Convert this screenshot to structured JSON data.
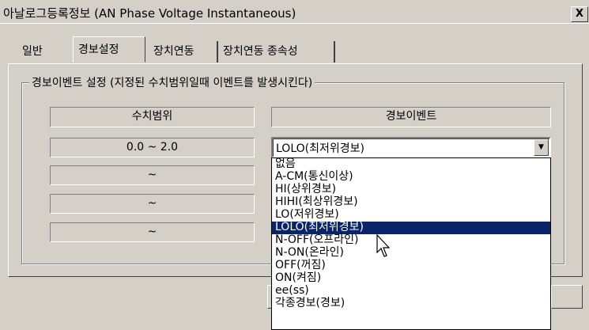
{
  "window": {
    "title": "아날로그등록정보 (AN Phase Voltage Instantaneous)",
    "close_label": "X"
  },
  "tabs": [
    "일반",
    "경보설정",
    "장치연동",
    "장치연동 종속성"
  ],
  "active_tab": "경보설정",
  "group": {
    "title": "경보이벤트 설정 (지정된 수치범위일때 이벤트를 발생시킨다)"
  },
  "table": {
    "headers": {
      "range": "수치범위",
      "event": "경보이벤트"
    },
    "rows": [
      {
        "range": "0.0 ~ 2.0",
        "event": "LOLO(최저위경보)"
      },
      {
        "range": "~"
      },
      {
        "range": "~"
      },
      {
        "range": "~"
      }
    ]
  },
  "dropdown": {
    "options": [
      "없음",
      "A-CM(통신이상)",
      "HI(상위경보)",
      "HIHI(최상위경보)",
      "LO(저위경보)",
      "LOLO(최저위경보)",
      "N-OFF(오프라인)",
      "N-ON(온라인)",
      "OFF(꺼짐)",
      "ON(켜짐)",
      "ee(ss)",
      "각종경보(경보)"
    ],
    "selected": "LOLO(최저위경보)"
  },
  "colors": {
    "face": "#d4d0c8",
    "highlight": "#0a246a"
  }
}
